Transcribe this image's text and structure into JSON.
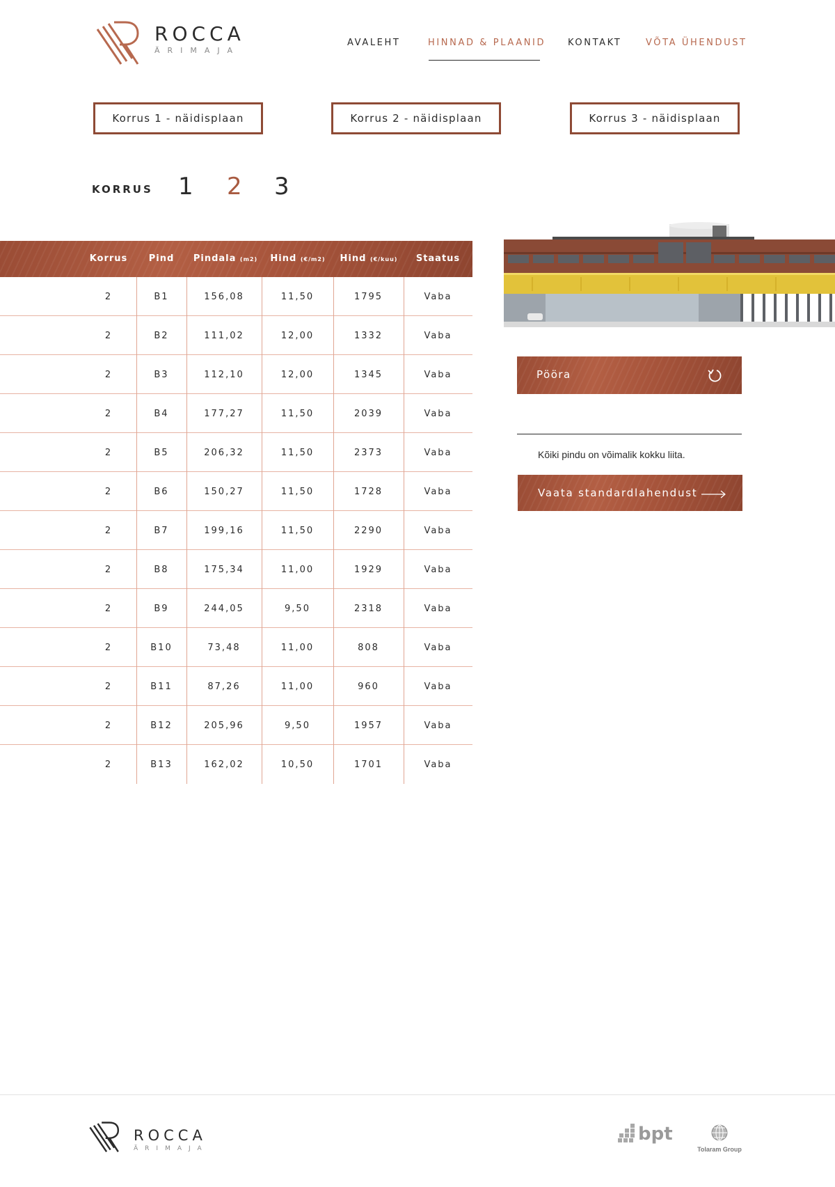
{
  "header": {
    "logo_title": "ROCCA",
    "logo_subtitle": "ÄRIMAJA",
    "nav": [
      {
        "label": "AVALEHT"
      },
      {
        "label": "HINNAD & PLAANID"
      },
      {
        "label": "KONTAKT"
      },
      {
        "label": "VÕTA ÜHENDUST"
      }
    ],
    "accent_color": "#b7694f"
  },
  "plan_buttons": [
    {
      "label": "Korrus 1  - näidisplaan"
    },
    {
      "label": "Korrus 2  - näidisplaan"
    },
    {
      "label": "Korrus 3  - näidisplaan"
    }
  ],
  "floor_selector": {
    "label": "KORRUS",
    "floors": [
      "1",
      "2",
      "3"
    ],
    "active": "2"
  },
  "table": {
    "columns": [
      {
        "label": "Korrus",
        "unit": ""
      },
      {
        "label": "Pind",
        "unit": ""
      },
      {
        "label": "Pindala",
        "unit": "(m2)"
      },
      {
        "label": "Hind",
        "unit": "(€/m2)"
      },
      {
        "label": "Hind",
        "unit": "(€/kuu)"
      },
      {
        "label": "Staatus",
        "unit": ""
      }
    ],
    "rows": [
      {
        "korrus": "2",
        "pind": "B1",
        "pindala": "156,08",
        "hind_m2": "11,50",
        "hind_kuu": "1795",
        "staatus": "Vaba"
      },
      {
        "korrus": "2",
        "pind": "B2",
        "pindala": "111,02",
        "hind_m2": "12,00",
        "hind_kuu": "1332",
        "staatus": "Vaba"
      },
      {
        "korrus": "2",
        "pind": "B3",
        "pindala": "112,10",
        "hind_m2": "12,00",
        "hind_kuu": "1345",
        "staatus": "Vaba"
      },
      {
        "korrus": "2",
        "pind": "B4",
        "pindala": "177,27",
        "hind_m2": "11,50",
        "hind_kuu": "2039",
        "staatus": "Vaba"
      },
      {
        "korrus": "2",
        "pind": "B5",
        "pindala": "206,32",
        "hind_m2": "11,50",
        "hind_kuu": "2373",
        "staatus": "Vaba"
      },
      {
        "korrus": "2",
        "pind": "B6",
        "pindala": "150,27",
        "hind_m2": "11,50",
        "hind_kuu": "1728",
        "staatus": "Vaba"
      },
      {
        "korrus": "2",
        "pind": "B7",
        "pindala": "199,16",
        "hind_m2": "11,50",
        "hind_kuu": "2290",
        "staatus": "Vaba"
      },
      {
        "korrus": "2",
        "pind": "B8",
        "pindala": "175,34",
        "hind_m2": "11,00",
        "hind_kuu": "1929",
        "staatus": "Vaba"
      },
      {
        "korrus": "2",
        "pind": "B9",
        "pindala": "244,05",
        "hind_m2": "9,50",
        "hind_kuu": "2318",
        "staatus": "Vaba"
      },
      {
        "korrus": "2",
        "pind": "B10",
        "pindala": "73,48",
        "hind_m2": "11,00",
        "hind_kuu": "808",
        "staatus": "Vaba"
      },
      {
        "korrus": "2",
        "pind": "B11",
        "pindala": "87,26",
        "hind_m2": "11,00",
        "hind_kuu": "960",
        "staatus": "Vaba"
      },
      {
        "korrus": "2",
        "pind": "B12",
        "pindala": "205,96",
        "hind_m2": "9,50",
        "hind_kuu": "1957",
        "staatus": "Vaba"
      },
      {
        "korrus": "2",
        "pind": "B13",
        "pindala": "162,02",
        "hind_m2": "10,50",
        "hind_kuu": "1701",
        "staatus": "Vaba"
      }
    ]
  },
  "side": {
    "rotate_label": "Pööra",
    "note": "Kõiki pindu on võimalik kokku liita.",
    "standard_label": "Vaata standardlahendust"
  },
  "footer": {
    "logo_title": "ROCCA",
    "logo_subtitle": "ÄRIMAJA",
    "partner1": "bpt",
    "partner2": "Tolaram Group"
  }
}
